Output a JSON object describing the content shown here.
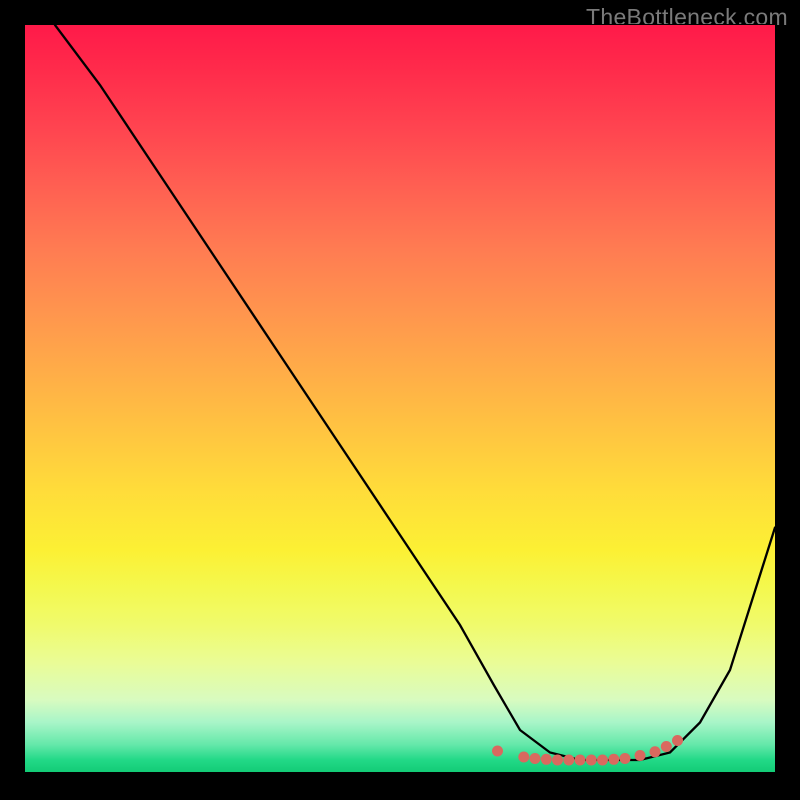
{
  "watermark": "TheBottleneck.com",
  "chart_data": {
    "type": "line",
    "title": "",
    "xlabel": "",
    "ylabel": "",
    "x_range": [
      0,
      100
    ],
    "y_range": [
      0,
      100
    ],
    "series": [
      {
        "name": "bottleneck-curve",
        "x": [
          4,
          10,
          18,
          26,
          34,
          42,
          50,
          58,
          62.5,
          66,
          70,
          74,
          78,
          82,
          86,
          90,
          94,
          100
        ],
        "y": [
          100,
          92,
          80,
          68,
          56,
          44,
          32,
          20,
          12,
          6,
          3,
          2,
          2,
          2,
          3,
          7,
          14,
          33
        ]
      }
    ],
    "marker_region": {
      "name": "optimal-dots",
      "color": "#d9695f",
      "points_x": [
        63,
        66.5,
        68,
        69.5,
        71,
        72.5,
        74,
        75.5,
        77,
        78.5,
        80,
        82,
        84,
        85.5,
        87
      ],
      "points_y": [
        3.2,
        2.4,
        2.2,
        2.1,
        2.0,
        2.0,
        2.0,
        2.0,
        2.0,
        2.1,
        2.2,
        2.6,
        3.1,
        3.8,
        4.6
      ]
    },
    "gradient": {
      "top_color": "#ff1a49",
      "mid_color": "#ffd83c",
      "bottom_color": "#0fc872"
    }
  }
}
